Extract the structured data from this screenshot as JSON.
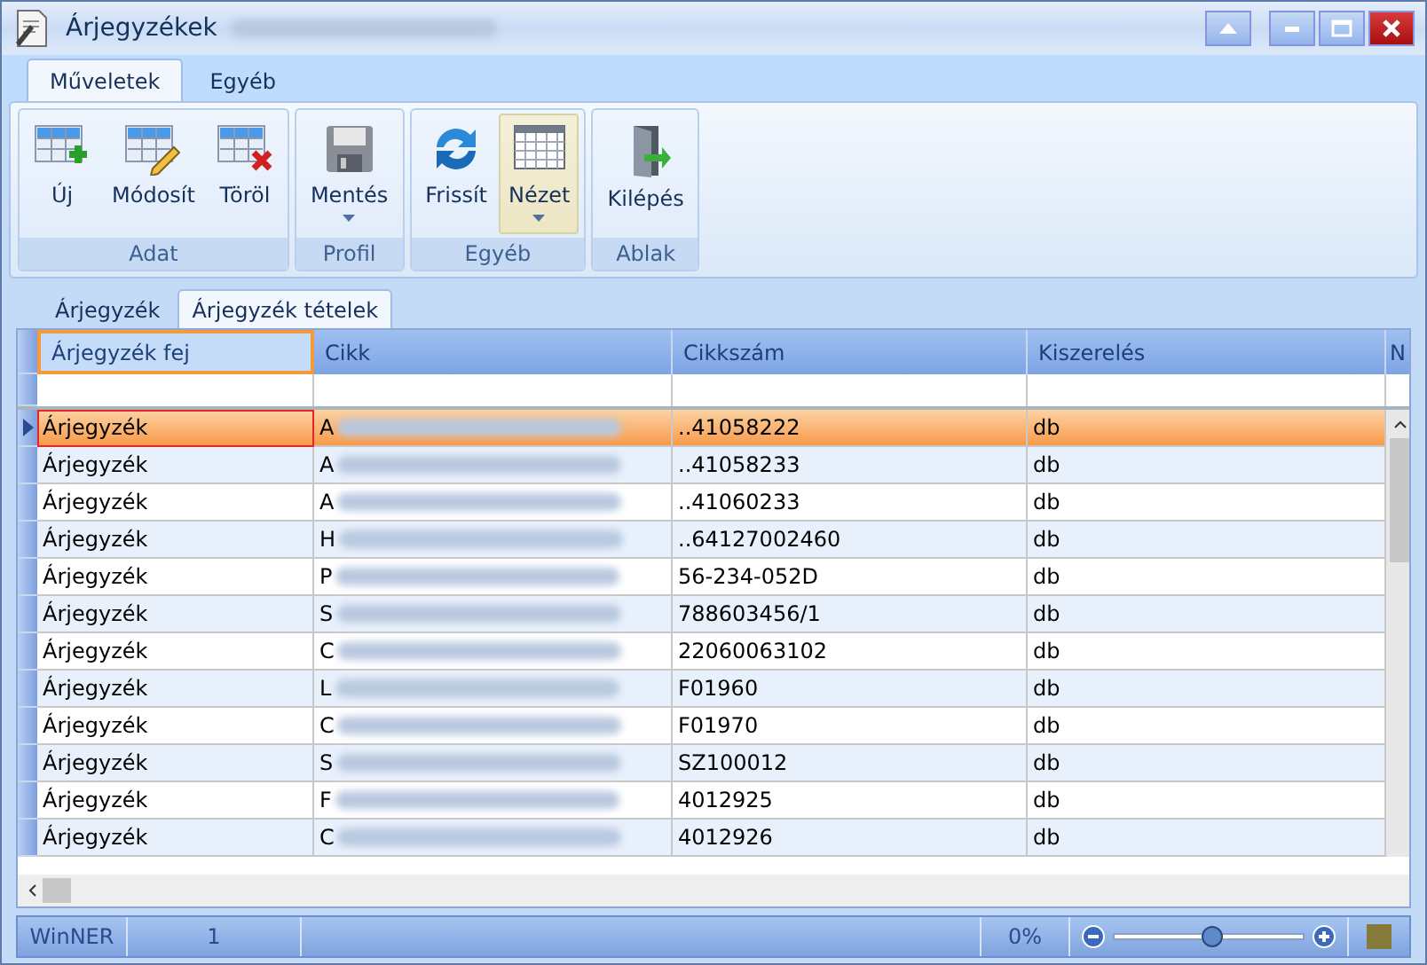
{
  "window": {
    "title": "Árjegyzékek"
  },
  "ribbon_tabs": [
    {
      "label": "Műveletek",
      "selected": true
    },
    {
      "label": "Egyéb",
      "selected": false
    }
  ],
  "ribbon_groups": [
    {
      "label": "Adat",
      "buttons": [
        {
          "label": "Új",
          "kind": "new",
          "dropdown": false,
          "highlighted": false
        },
        {
          "label": "Módosít",
          "kind": "edit",
          "dropdown": false,
          "highlighted": false
        },
        {
          "label": "Töröl",
          "kind": "delete",
          "dropdown": false,
          "highlighted": false
        }
      ]
    },
    {
      "label": "Profil",
      "buttons": [
        {
          "label": "Mentés",
          "kind": "save",
          "dropdown": true,
          "highlighted": false
        }
      ]
    },
    {
      "label": "Egyéb",
      "buttons": [
        {
          "label": "Frissít",
          "kind": "refresh",
          "dropdown": false,
          "highlighted": false
        },
        {
          "label": "Nézet",
          "kind": "grid",
          "dropdown": true,
          "highlighted": true
        }
      ]
    },
    {
      "label": "Ablak",
      "buttons": [
        {
          "label": "Kilépés",
          "kind": "exit",
          "dropdown": false,
          "highlighted": false
        }
      ]
    }
  ],
  "doc_tabs": [
    {
      "label": "Árjegyzék",
      "selected": false
    },
    {
      "label": "Árjegyzék tételek",
      "selected": true
    }
  ],
  "table": {
    "columns": [
      "Árjegyzék fej",
      "Cikk",
      "Cikkszám",
      "Kiszerelés",
      "N"
    ],
    "rows": [
      {
        "cells": [
          "Árjegyzék",
          "A",
          "..41058222",
          "db"
        ],
        "selected": true
      },
      {
        "cells": [
          "Árjegyzék",
          "A",
          "..41058233",
          "db"
        ],
        "selected": false
      },
      {
        "cells": [
          "Árjegyzék",
          "A",
          "..41060233",
          "db"
        ],
        "selected": false
      },
      {
        "cells": [
          "Árjegyzék",
          "H",
          "..64127002460",
          "db"
        ],
        "selected": false
      },
      {
        "cells": [
          "Árjegyzék",
          "P",
          "56-234-052D",
          "db"
        ],
        "selected": false
      },
      {
        "cells": [
          "Árjegyzék",
          "S",
          "788603456/1",
          "db"
        ],
        "selected": false
      },
      {
        "cells": [
          "Árjegyzék",
          "C",
          "22060063102",
          "db"
        ],
        "selected": false
      },
      {
        "cells": [
          "Árjegyzék",
          "L",
          "F01960",
          "db"
        ],
        "selected": false
      },
      {
        "cells": [
          "Árjegyzék",
          "C",
          "F01970",
          "db"
        ],
        "selected": false
      },
      {
        "cells": [
          "Árjegyzék",
          "S",
          "SZ100012",
          "db"
        ],
        "selected": false
      },
      {
        "cells": [
          "Árjegyzék",
          "F",
          "4012925",
          "db"
        ],
        "selected": false
      },
      {
        "cells": [
          "Árjegyzék",
          "C",
          "4012926",
          "db"
        ],
        "selected": false
      }
    ]
  },
  "status_bar": {
    "app": "WinNER",
    "count": "1",
    "zoom_text": "0%",
    "zoom": {
      "level": 0.52
    }
  }
}
